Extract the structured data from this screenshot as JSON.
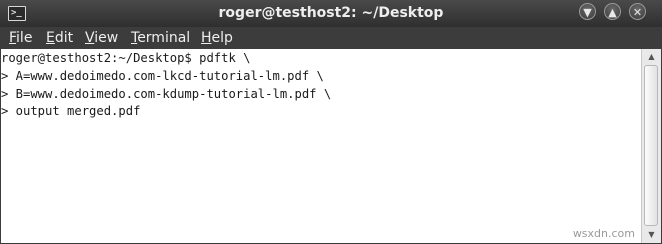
{
  "window": {
    "title": "roger@testhost2: ~/Desktop",
    "icon": "terminal-icon",
    "controls": {
      "minimize": "minimize-icon",
      "maximize": "maximize-icon",
      "close": "close-icon"
    }
  },
  "menubar": {
    "items": [
      {
        "label": "File",
        "accel": "F",
        "rest": "ile"
      },
      {
        "label": "Edit",
        "accel": "E",
        "rest": "dit"
      },
      {
        "label": "View",
        "accel": "V",
        "rest": "iew"
      },
      {
        "label": "Terminal",
        "accel": "T",
        "rest": "erminal"
      },
      {
        "label": "Help",
        "accel": "H",
        "rest": "elp"
      }
    ]
  },
  "terminal": {
    "lines": [
      "roger@testhost2:~/Desktop$ pdftk \\",
      "> A=www.dedoimedo.com-lkcd-tutorial-lm.pdf \\",
      "> B=www.dedoimedo.com-kdump-tutorial-lm.pdf \\",
      "> output merged.pdf"
    ]
  },
  "watermark": "wsxdn.com",
  "colors": {
    "titlebar": "#3b3b3b",
    "terminal_bg": "#ffffff",
    "terminal_fg": "#1a1a1a"
  }
}
